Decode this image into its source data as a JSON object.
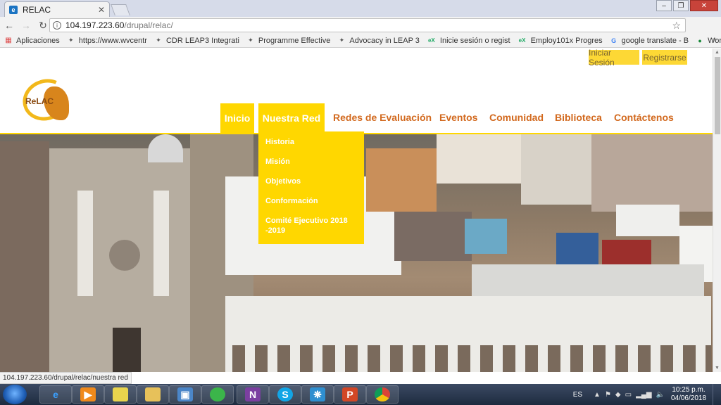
{
  "browser": {
    "tab_title": "RELAC",
    "url_host": "104.197.223.60",
    "url_path": "/drupal/relac/",
    "status_url": "104.197.223.60/drupal/relac/nuestra red"
  },
  "bookmarks": [
    {
      "label": "Aplicaciones",
      "icon": "apps-grid-icon"
    },
    {
      "label": "https://www.wvcentr",
      "icon": "leap-icon"
    },
    {
      "label": "CDR LEAP3 Integrati",
      "icon": "leap-icon"
    },
    {
      "label": "Programme Effective",
      "icon": "leap-icon"
    },
    {
      "label": "Advocacy in LEAP 3",
      "icon": "leap-icon"
    },
    {
      "label": "Inicie sesión o regist",
      "icon": "edx-icon"
    },
    {
      "label": "Employ101x Progres",
      "icon": "edx-icon"
    },
    {
      "label": "google translate - B",
      "icon": "google-icon"
    },
    {
      "label": "World Vision Interna",
      "icon": "globe-icon"
    }
  ],
  "site": {
    "logo_text": "ReLAC",
    "auth": {
      "login": "Iniciar Sesión",
      "register": "Registrarse"
    },
    "nav": [
      {
        "label": "Inicio",
        "active": true
      },
      {
        "label": "Nuestra Red",
        "active": true
      },
      {
        "label": "Redes de Evaluación",
        "active": false
      },
      {
        "label": "Eventos",
        "active": false
      },
      {
        "label": "Comunidad",
        "active": false
      },
      {
        "label": "Biblioteca",
        "active": false
      },
      {
        "label": "Contáctenos",
        "active": false
      }
    ],
    "dropdown": [
      "Historia",
      "Misión",
      "Objetivos",
      "Conformación",
      "Comité Ejecutivo 2018 -2019"
    ]
  },
  "taskbar": {
    "apps": [
      "internet-explorer-icon",
      "media-player-icon",
      "sticky-notes-icon",
      "file-explorer-icon",
      "remote-desktop-icon",
      "green-sphere-icon",
      "onenote-icon",
      "skype-icon",
      "network-icon",
      "powerpoint-icon",
      "chrome-icon"
    ],
    "language": "ES",
    "time": "10:25 p.m.",
    "date": "04/06/2018"
  },
  "colors": {
    "accent": "#ffd700",
    "nav_text": "#d2691e",
    "auth_button": "#fdd835"
  }
}
